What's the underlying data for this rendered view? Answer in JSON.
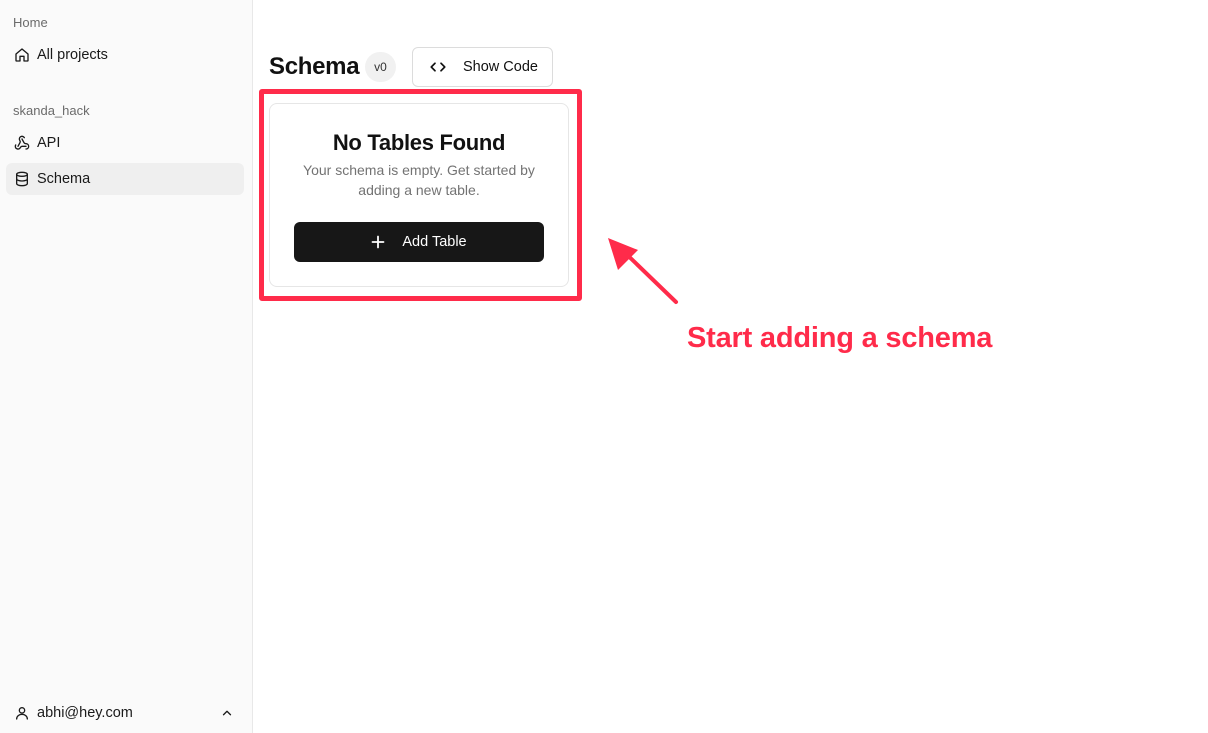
{
  "sidebar": {
    "home_label": "Home",
    "all_projects": {
      "label": "All projects",
      "icon": "home-icon"
    },
    "project_label": "skanda_hack",
    "items": [
      {
        "label": "API",
        "icon": "webhook-icon"
      },
      {
        "label": "Schema",
        "icon": "database-icon",
        "active": true
      }
    ],
    "user": {
      "email": "abhi@hey.com",
      "icon": "user-icon",
      "toggle_icon": "chevron-up-icon"
    }
  },
  "header": {
    "title": "Schema",
    "version": "v0",
    "show_code_label": "Show Code",
    "show_code_icon": "code-icon"
  },
  "empty_state": {
    "title": "No Tables Found",
    "description": "Your schema is empty. Get started by adding a new table.",
    "add_button_label": "Add Table",
    "add_button_icon": "plus-icon"
  },
  "annotation": {
    "text": "Start adding a schema",
    "color": "#ff2b4a"
  },
  "colors": {
    "accent_annotation": "#ff2b4a",
    "primary_button": "#171717",
    "sidebar_bg": "#fafafa"
  }
}
